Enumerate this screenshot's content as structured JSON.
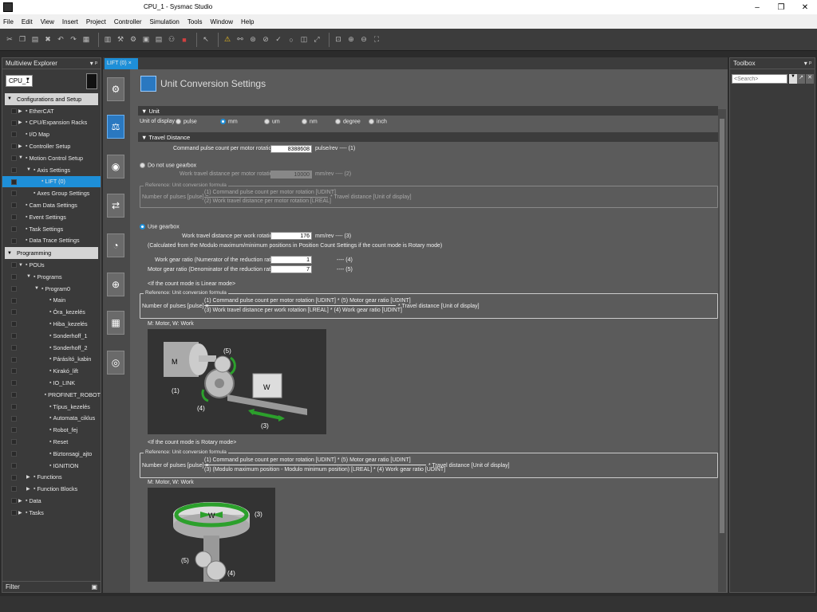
{
  "window": {
    "title": "CPU_1 - Sysmac Studio",
    "controls": [
      "–",
      "❐",
      "✕"
    ]
  },
  "menu": [
    "File",
    "Edit",
    "View",
    "Insert",
    "Project",
    "Controller",
    "Simulation",
    "Tools",
    "Window",
    "Help"
  ],
  "toolbar_icons": [
    "cut-icon",
    "copy-icon",
    "paste-icon",
    "delete-icon",
    "undo-icon",
    "redo-icon",
    "edit-icon",
    "build-icon",
    "tools-icon",
    "settings-icon",
    "compare-icon",
    "find-icon",
    "binoculars-icon",
    "stop-icon",
    "cursor-icon",
    "warning-icon",
    "link-icon",
    "target-icon",
    "reset-icon",
    "refresh-icon",
    "zoom-fit-icon",
    "zoom-in-icon",
    "zoom-out-icon",
    "fullscreen-icon"
  ],
  "left": {
    "header": "Multiview Explorer",
    "cpu": "CPU_1",
    "footer": "Filter",
    "tree": [
      {
        "label": "Configurations and Setup",
        "indent": 0,
        "type": "section"
      },
      {
        "label": "EtherCAT",
        "indent": 1,
        "arrow": "▶"
      },
      {
        "label": "CPU/Expansion Racks",
        "indent": 1,
        "arrow": "▶"
      },
      {
        "label": "I/O Map",
        "indent": 1,
        "arrow": ""
      },
      {
        "label": "Controller Setup",
        "indent": 1,
        "arrow": "▶"
      },
      {
        "label": "Motion Control Setup",
        "indent": 1,
        "arrow": "▼"
      },
      {
        "label": "Axis Settings",
        "indent": 2,
        "arrow": "▼"
      },
      {
        "label": "LIFT (0)",
        "indent": 3,
        "arrow": "",
        "selected": true
      },
      {
        "label": "Axes Group Settings",
        "indent": 2,
        "arrow": ""
      },
      {
        "label": "Cam Data Settings",
        "indent": 1,
        "arrow": ""
      },
      {
        "label": "Event Settings",
        "indent": 1,
        "arrow": ""
      },
      {
        "label": "Task Settings",
        "indent": 1,
        "arrow": ""
      },
      {
        "label": "Data Trace Settings",
        "indent": 1,
        "arrow": ""
      },
      {
        "label": "Programming",
        "indent": 0,
        "type": "section"
      },
      {
        "label": "POUs",
        "indent": 1,
        "arrow": "▼"
      },
      {
        "label": "Programs",
        "indent": 2,
        "arrow": "▼"
      },
      {
        "label": "Program0",
        "indent": 3,
        "arrow": "▼"
      },
      {
        "label": "Main",
        "indent": 4,
        "arrow": ""
      },
      {
        "label": "Óra_kezelés",
        "indent": 4,
        "arrow": ""
      },
      {
        "label": "Hiba_kezelés",
        "indent": 4,
        "arrow": ""
      },
      {
        "label": "Sonderhoff_1",
        "indent": 4,
        "arrow": ""
      },
      {
        "label": "Sonderhoff_2",
        "indent": 4,
        "arrow": ""
      },
      {
        "label": "Párásító_kabin",
        "indent": 4,
        "arrow": ""
      },
      {
        "label": "Kirakó_lift",
        "indent": 4,
        "arrow": ""
      },
      {
        "label": "IO_LINK",
        "indent": 4,
        "arrow": ""
      },
      {
        "label": "PROFINET_ROBOT",
        "indent": 4,
        "arrow": ""
      },
      {
        "label": "Típus_kezelés",
        "indent": 4,
        "arrow": ""
      },
      {
        "label": "Automata_ciklus",
        "indent": 4,
        "arrow": ""
      },
      {
        "label": "Robot_fej",
        "indent": 4,
        "arrow": ""
      },
      {
        "label": "Reset",
        "indent": 4,
        "arrow": ""
      },
      {
        "label": "Biztonsagi_ajto",
        "indent": 4,
        "arrow": ""
      },
      {
        "label": "IGNITION",
        "indent": 4,
        "arrow": ""
      },
      {
        "label": "Functions",
        "indent": 2,
        "arrow": "▶"
      },
      {
        "label": "Function Blocks",
        "indent": 2,
        "arrow": "▶"
      },
      {
        "label": "Data",
        "indent": 1,
        "arrow": "▶"
      },
      {
        "label": "Tasks",
        "indent": 1,
        "arrow": "▶"
      }
    ]
  },
  "tab": {
    "label": "LIFT (0)",
    "close": "×"
  },
  "page": {
    "title": "Unit Conversion Settings",
    "unit_section": "▼ Unit",
    "unit_of_display_label": "Unit of display",
    "units": [
      "pulse",
      "mm",
      "um",
      "nm",
      "degree",
      "inch"
    ],
    "selected_unit": "mm",
    "travel_section": "▼ Travel Distance",
    "cmd_pulse_label": "Command pulse count per motor rotation",
    "cmd_pulse_value": "8388608",
    "cmd_pulse_unit": "pulse/rev ---- (1)",
    "no_gearbox_label": "Do not use gearbox",
    "work_travel_label": "Work travel distance per motor rotation",
    "work_travel_value": "10000",
    "work_travel_unit": "mm/rev   ---- (2)",
    "ref_label": "Reference: Unit conversion formula",
    "pulses_label": "Number of pulses [pulse] =",
    "formula_a_num": "(1) Command pulse count per motor rotation [UDINT]",
    "formula_a_den": "(2) Work travel distance per motor rotation [LREAL]",
    "formula_a_tail": "* Travel distance [Unit of display]",
    "use_gearbox_label": "Use gearbox",
    "work_travel_rot_label": "Work travel distance per work rotation",
    "work_travel_rot_value": "176",
    "work_travel_rot_unit": "mm/rev    ---- (3)",
    "calc_note": "(Calculated from the Modulo maximum/minimum positions in Position Count Settings if the count mode is Rotary mode)",
    "num_label": "Work gear ratio (Numerator of the reduction ratio)",
    "num_value": "1",
    "num_suffix": "---- (4)",
    "den_label": "Motor gear ratio (Denominator of the reduction ratio)",
    "den_value": "7",
    "den_suffix": "---- (5)",
    "linear_note": "<If the count mode is Linear mode>",
    "formula_b_num": "(1) Command pulse count per motor rotation [UDINT] * (5) Motor gear ratio [UDINT]",
    "formula_b_den": "(3) Work travel distance per work rotation [LREAL] * (4) Work gear ratio [UDINT]",
    "formula_b_tail": "* Travel distance [Unit of display]",
    "legend_text": "M: Motor, W: Work",
    "rotary_note": "<If the count mode is Rotary mode>",
    "formula_c_num": "(1) Command pulse count per motor rotation [UDINT] * (5) Motor gear ratio [UDINT]",
    "formula_c_den": "(3) (Modulo maximum position - Modulo minimum position) [LREAL] * (4) Work gear ratio [UDINT]",
    "formula_c_tail": "* Travel distance [Unit of display]",
    "fig1_labels": {
      "m": "M",
      "w": "W",
      "l1": "(1)",
      "l3": "(3)",
      "l4": "(4)",
      "l5": "(5)"
    },
    "fig2_labels": {
      "w": "W",
      "l3": "(3)",
      "l4": "(4)",
      "l5": "(5)"
    }
  },
  "right": {
    "header": "Toolbox",
    "search_placeholder": "<Search>"
  },
  "colors": {
    "accent": "#1e8fd8",
    "green": "#2ca02c"
  }
}
